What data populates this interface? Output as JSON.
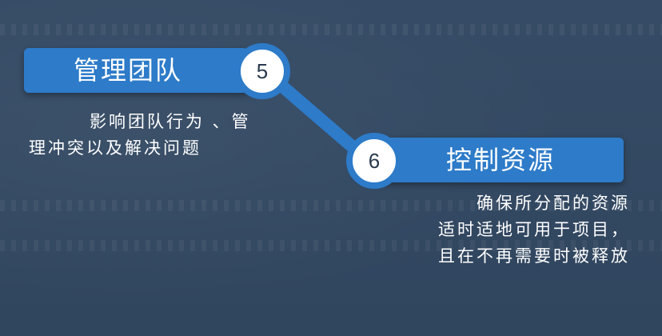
{
  "steps": [
    {
      "number": "5",
      "title": "管理团队",
      "description_lines": [
        "影响团队行为 、管",
        "理冲突以及解决问题"
      ]
    },
    {
      "number": "6",
      "title": "控制资源",
      "description_lines": [
        "确保所分配的资源",
        "适时适地可用于项目，",
        "且在不再需要时被释放"
      ]
    }
  ],
  "colors": {
    "background": "#344a64",
    "banner": "#2d7bc9",
    "badge_fill": "#ffffff",
    "text": "#ffffff"
  }
}
